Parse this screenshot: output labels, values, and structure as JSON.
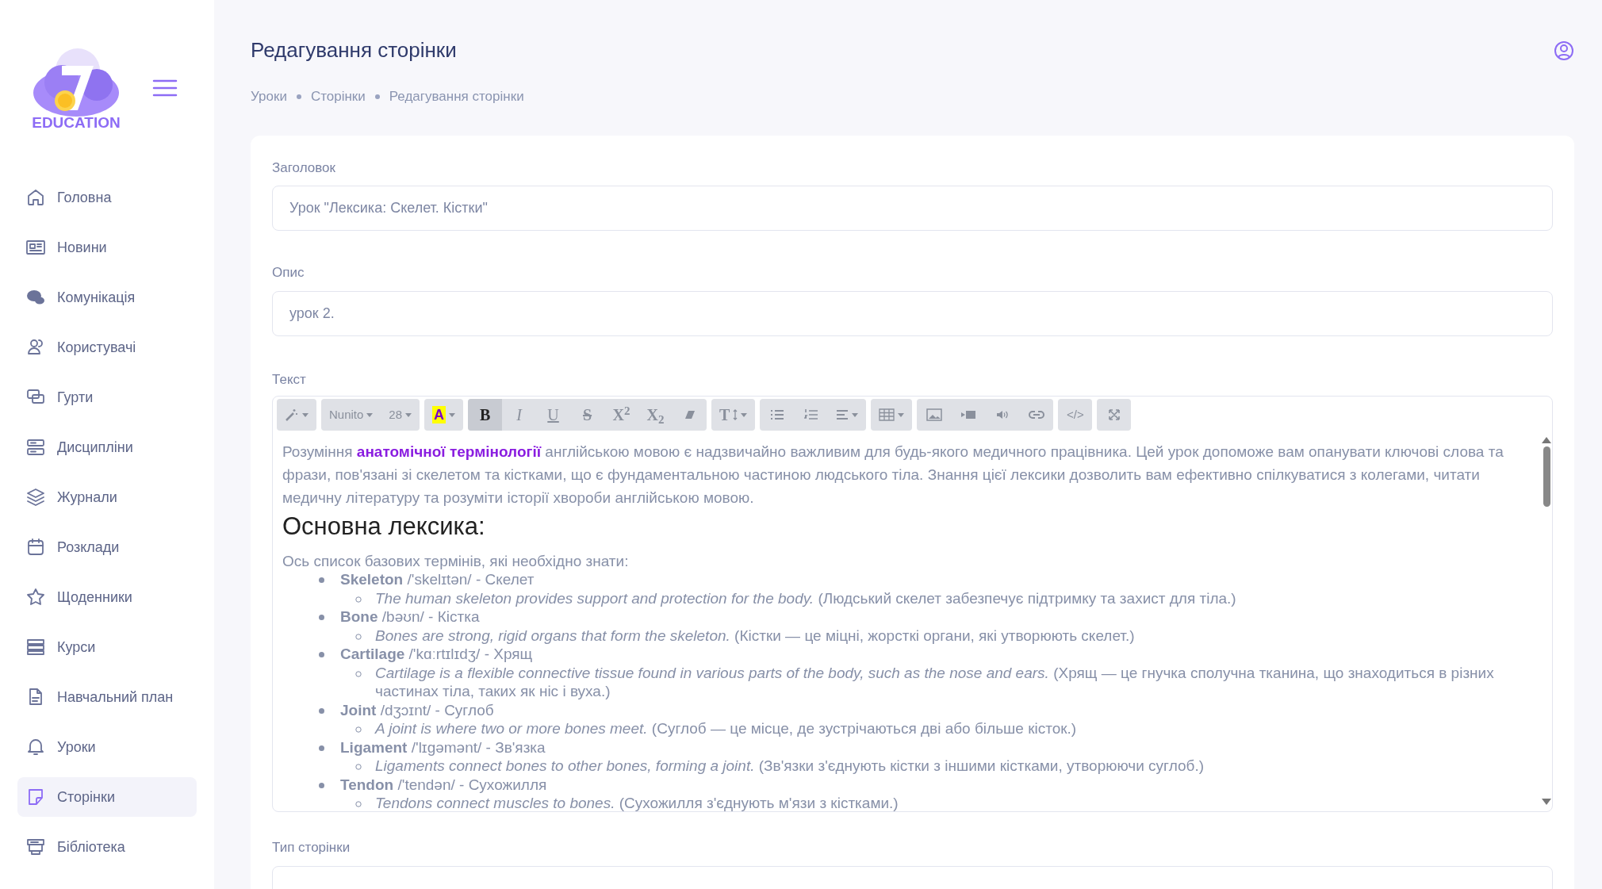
{
  "sidebar": {
    "logo_text": "EDUCATION",
    "items": [
      {
        "label": "Головна",
        "kind": "home",
        "selected": false
      },
      {
        "label": "Новини",
        "kind": "news",
        "selected": false
      },
      {
        "label": "Комунікація",
        "kind": "chat",
        "selected": false
      },
      {
        "label": "Користувачі",
        "kind": "users",
        "selected": false
      },
      {
        "label": "Гурти",
        "kind": "groups",
        "selected": false
      },
      {
        "label": "Дисципліни",
        "kind": "server",
        "selected": false
      },
      {
        "label": "Журнали",
        "kind": "layers",
        "selected": false
      },
      {
        "label": "Розклади",
        "kind": "calendar",
        "selected": false
      },
      {
        "label": "Щоденники",
        "kind": "star",
        "selected": false
      },
      {
        "label": "Курси",
        "kind": "stack",
        "selected": false
      },
      {
        "label": "Навчальний план",
        "kind": "file",
        "selected": false
      },
      {
        "label": "Уроки",
        "kind": "bell",
        "selected": false
      },
      {
        "label": "Сторінки",
        "kind": "note",
        "selected": true
      },
      {
        "label": "Бібліотека",
        "kind": "library",
        "selected": false
      }
    ]
  },
  "header": {
    "title": "Редагування сторінки",
    "breadcrumbs": [
      "Уроки",
      "Сторінки",
      "Редагування сторінки"
    ]
  },
  "form": {
    "title_field": {
      "label": "Заголовок",
      "value": "Урок \"Лексика: Скелет. Кістки\""
    },
    "description_field": {
      "label": "Опис",
      "value": "урок 2."
    },
    "text_editor": {
      "label": "Текст",
      "toolbar": [
        [
          {
            "kind": "magic",
            "active": false
          }
        ],
        [
          {
            "kind": "font",
            "text": "Nunito",
            "active": false
          },
          {
            "kind": "size",
            "text": "28",
            "active": false
          }
        ],
        [
          {
            "kind": "color",
            "text": "A",
            "active": false
          }
        ],
        [
          {
            "kind": "bold",
            "text": "B",
            "active": true
          },
          {
            "kind": "italic",
            "text": "I",
            "active": false
          },
          {
            "kind": "underline",
            "text": "U",
            "active": false
          },
          {
            "kind": "strike",
            "text": "S",
            "active": false
          },
          {
            "kind": "sup",
            "text": "X$^{2}$",
            "active": false
          },
          {
            "kind": "sub",
            "text": "X$_{2}$",
            "active": false
          },
          {
            "kind": "eraser",
            "active": false
          }
        ],
        [
          {
            "kind": "height",
            "text": "T",
            "active": false
          }
        ],
        [
          {
            "kind": "ul",
            "active": false
          },
          {
            "kind": "ol",
            "active": false
          },
          {
            "kind": "align",
            "active": false
          }
        ],
        [
          {
            "kind": "table",
            "active": false
          }
        ],
        [
          {
            "kind": "image",
            "active": false
          },
          {
            "kind": "video",
            "active": false
          },
          {
            "kind": "audio",
            "active": false
          },
          {
            "kind": "link",
            "active": false
          }
        ],
        [
          {
            "kind": "code",
            "text": "</>",
            "active": false
          }
        ],
        [
          {
            "kind": "fullscreen",
            "active": false
          }
        ]
      ],
      "content": {
        "intro": "Розуміння **анатомічної термінології** англійською мовою є надзвичайно важливим для будь-якого медичного працівника. Цей урок допоможе вам опанувати ключові слова та фрази, пов'язані зі скелетом та кістками, що є фундаментальною частиною людського тіла. Знання цієї лексики дозволить вам ефективно спілкуватися з колегами, читати медичну літературу та розуміти історії хвороби англійською мовою.",
        "heading": "Основна лексика:",
        "list_intro": "Ось список базових термінів, які необхідно знати:",
        "terms": [
          {
            "term": "Skeleton",
            "gloss": "/'skelɪtən/ - Скелет",
            "example": "The human skeleton provides support and protection for the body.",
            "translation": "(Людський скелет забезпечує підтримку та захист для тіла.)"
          },
          {
            "term": "Bone",
            "gloss": "/bəʊn/ - Кістка",
            "example": "Bones are strong, rigid organs that form the skeleton.",
            "translation": "(Кістки — це міцні, жорсткі органи, які утворюють скелет.)"
          },
          {
            "term": "Cartilage",
            "gloss": "/'kɑːrtɪlɪdʒ/ - Хрящ",
            "example": "Cartilage is a flexible connective tissue found in various parts of the body, such as the nose and ears.",
            "translation": "(Хрящ — це гнучка сполучна тканина, що знаходиться в різних частинах тіла, таких як ніс і вуха.)"
          },
          {
            "term": "Joint",
            "gloss": "/dʒɔɪnt/ - Суглоб",
            "example": "A joint is where two or more bones meet.",
            "translation": "(Суглоб — це місце, де зустрічаються дві або більше кісток.)"
          },
          {
            "term": "Ligament",
            "gloss": "/'lɪɡəmənt/ - Зв'язка",
            "example": "Ligaments connect bones to other bones, forming a joint.",
            "translation": "(Зв'язки з'єднують кістки з іншими кістками, утворюючи суглоб.)"
          },
          {
            "term": "Tendon",
            "gloss": "/'tendən/ - Сухожилля",
            "example": "Tendons connect muscles to bones.",
            "translation": "(Сухожилля з'єднують м'язи з кістками.)"
          }
        ]
      }
    },
    "page_type_field": {
      "label": "Тип сторінки"
    }
  }
}
